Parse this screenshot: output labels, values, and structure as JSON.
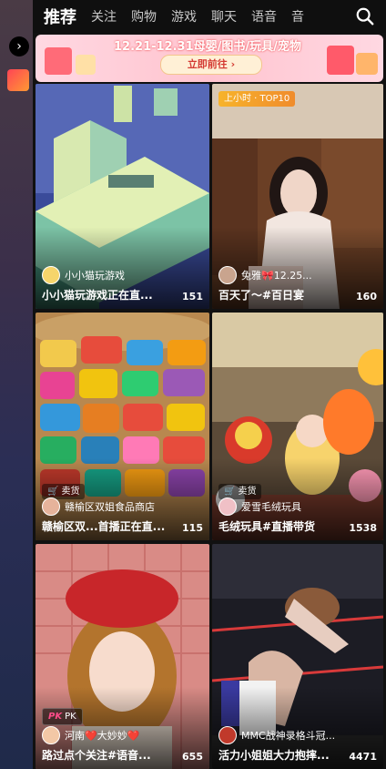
{
  "nav": {
    "tabs": [
      "推荐",
      "关注",
      "购物",
      "游戏",
      "聊天",
      "语音",
      "音"
    ]
  },
  "banner": {
    "text": "12.21-12.31母婴/图书/玩具/宠物",
    "button": "立即前往 ›"
  },
  "cards": [
    {
      "author": "小小猫玩游戏",
      "title": "小小猫玩游戏正在直...",
      "count": "151",
      "badge": ""
    },
    {
      "author": "兔雅🎀12.25...",
      "title": "百天了～#百日宴",
      "count": "160",
      "badge": "上小时 · TOP10"
    },
    {
      "author": "赣榆区双姐食品商店",
      "title": "赣榆区双...首播正在直...",
      "count": "115",
      "badge": "卖货"
    },
    {
      "author": "爱雪毛绒玩具",
      "title": "毛绒玩具#直播带货",
      "count": "1538",
      "badge": "卖货"
    },
    {
      "author": "河南❤️大妙妙❤️",
      "title": "路过点个关注#语音...",
      "count": "655",
      "badge": "PK"
    },
    {
      "author": "MMC战神录格斗冠...",
      "title": "活力小姐姐大力抱摔...",
      "count": "4471",
      "badge": ""
    }
  ],
  "colors": {
    "banner_bg": "#ffc4cf",
    "top_badge": "#f7b32b",
    "accent_red": "#d43b33"
  }
}
